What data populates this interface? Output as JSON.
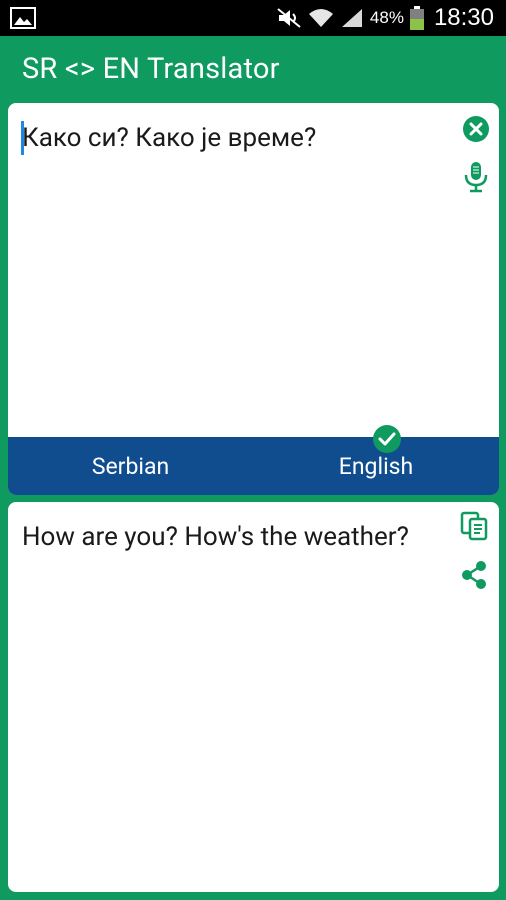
{
  "status_bar": {
    "battery_percent": "48%",
    "time": "18:30",
    "icons": [
      "gallery-icon",
      "mute-icon",
      "wifi-icon",
      "signal-icon",
      "battery-icon"
    ]
  },
  "app_bar": {
    "title": "SR <> EN Translator"
  },
  "input": {
    "text": "Како си? Како је време?",
    "icons": [
      "clear-icon",
      "microphone-icon"
    ]
  },
  "languages": {
    "source": "Serbian",
    "target": "English",
    "selected": "English"
  },
  "output": {
    "text": "How are you? How's the weather?",
    "icons": [
      "copy-icon",
      "share-icon"
    ]
  },
  "colors": {
    "primary": "#0f9b5f",
    "lang_bar": "#0f4d8e",
    "status_bar": "#000000",
    "card": "#ffffff"
  }
}
